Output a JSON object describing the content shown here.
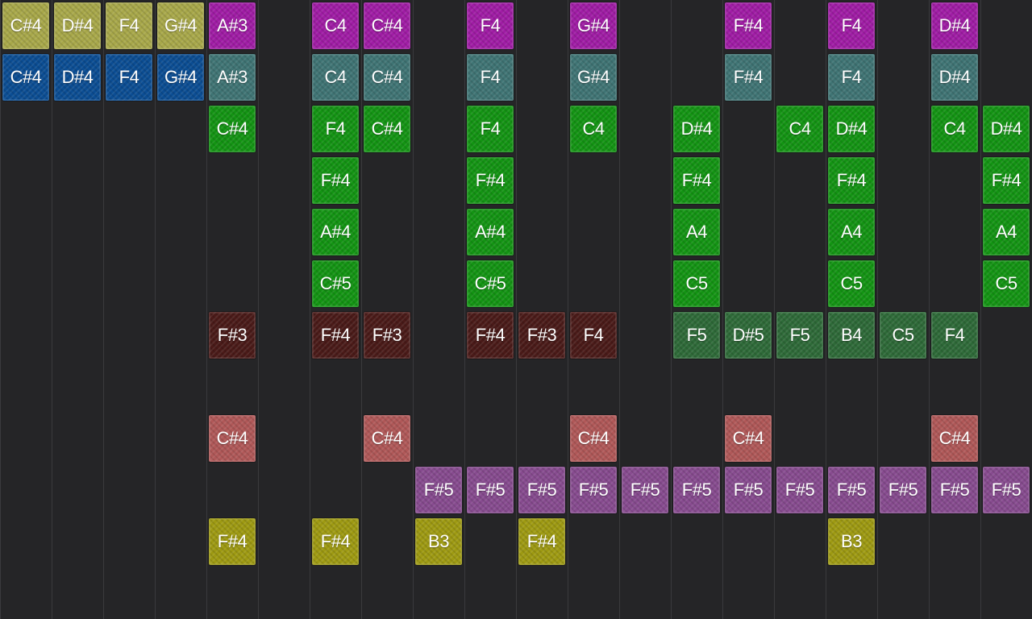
{
  "grid": {
    "columns": 20,
    "rows": 12
  },
  "colors": {
    "olive": "#a8a84a",
    "blue": "#0b4d93",
    "magenta": "#a01ca5",
    "teal": "#3f7474",
    "green": "#139413",
    "maroon": "#4a1a18",
    "darkgreen": "#2e6a38",
    "salmon": "#b05858",
    "purple": "#874b8f",
    "yellow": "#9e9a12"
  },
  "notes": [
    {
      "row": 0,
      "col": 0,
      "label": "C#4",
      "color": "olive"
    },
    {
      "row": 0,
      "col": 1,
      "label": "D#4",
      "color": "olive"
    },
    {
      "row": 0,
      "col": 2,
      "label": "F4",
      "color": "olive"
    },
    {
      "row": 0,
      "col": 3,
      "label": "G#4",
      "color": "olive"
    },
    {
      "row": 0,
      "col": 4,
      "label": "A#3",
      "color": "magenta"
    },
    {
      "row": 0,
      "col": 6,
      "label": "C4",
      "color": "magenta"
    },
    {
      "row": 0,
      "col": 7,
      "label": "C#4",
      "color": "magenta"
    },
    {
      "row": 0,
      "col": 9,
      "label": "F4",
      "color": "magenta"
    },
    {
      "row": 0,
      "col": 11,
      "label": "G#4",
      "color": "magenta"
    },
    {
      "row": 0,
      "col": 14,
      "label": "F#4",
      "color": "magenta"
    },
    {
      "row": 0,
      "col": 16,
      "label": "F4",
      "color": "magenta"
    },
    {
      "row": 0,
      "col": 18,
      "label": "D#4",
      "color": "magenta"
    },
    {
      "row": 1,
      "col": 0,
      "label": "C#4",
      "color": "blue"
    },
    {
      "row": 1,
      "col": 1,
      "label": "D#4",
      "color": "blue"
    },
    {
      "row": 1,
      "col": 2,
      "label": "F4",
      "color": "blue"
    },
    {
      "row": 1,
      "col": 3,
      "label": "G#4",
      "color": "blue"
    },
    {
      "row": 1,
      "col": 4,
      "label": "A#3",
      "color": "teal"
    },
    {
      "row": 1,
      "col": 6,
      "label": "C4",
      "color": "teal"
    },
    {
      "row": 1,
      "col": 7,
      "label": "C#4",
      "color": "teal"
    },
    {
      "row": 1,
      "col": 9,
      "label": "F4",
      "color": "teal"
    },
    {
      "row": 1,
      "col": 11,
      "label": "G#4",
      "color": "teal"
    },
    {
      "row": 1,
      "col": 14,
      "label": "F#4",
      "color": "teal"
    },
    {
      "row": 1,
      "col": 16,
      "label": "F4",
      "color": "teal"
    },
    {
      "row": 1,
      "col": 18,
      "label": "D#4",
      "color": "teal"
    },
    {
      "row": 2,
      "col": 4,
      "label": "C#4",
      "color": "green"
    },
    {
      "row": 2,
      "col": 6,
      "label": "F4",
      "color": "green"
    },
    {
      "row": 2,
      "col": 7,
      "label": "C#4",
      "color": "green"
    },
    {
      "row": 2,
      "col": 9,
      "label": "F4",
      "color": "green"
    },
    {
      "row": 2,
      "col": 11,
      "label": "C4",
      "color": "green"
    },
    {
      "row": 2,
      "col": 13,
      "label": "D#4",
      "color": "green"
    },
    {
      "row": 2,
      "col": 15,
      "label": "C4",
      "color": "green"
    },
    {
      "row": 2,
      "col": 16,
      "label": "D#4",
      "color": "green"
    },
    {
      "row": 2,
      "col": 18,
      "label": "C4",
      "color": "green"
    },
    {
      "row": 2,
      "col": 19,
      "label": "D#4",
      "color": "green"
    },
    {
      "row": 3,
      "col": 6,
      "label": "F#4",
      "color": "green"
    },
    {
      "row": 3,
      "col": 9,
      "label": "F#4",
      "color": "green"
    },
    {
      "row": 3,
      "col": 13,
      "label": "F#4",
      "color": "green"
    },
    {
      "row": 3,
      "col": 16,
      "label": "F#4",
      "color": "green"
    },
    {
      "row": 3,
      "col": 19,
      "label": "F#4",
      "color": "green"
    },
    {
      "row": 4,
      "col": 6,
      "label": "A#4",
      "color": "green"
    },
    {
      "row": 4,
      "col": 9,
      "label": "A#4",
      "color": "green"
    },
    {
      "row": 4,
      "col": 13,
      "label": "A4",
      "color": "green"
    },
    {
      "row": 4,
      "col": 16,
      "label": "A4",
      "color": "green"
    },
    {
      "row": 4,
      "col": 19,
      "label": "A4",
      "color": "green"
    },
    {
      "row": 5,
      "col": 6,
      "label": "C#5",
      "color": "green"
    },
    {
      "row": 5,
      "col": 9,
      "label": "C#5",
      "color": "green"
    },
    {
      "row": 5,
      "col": 13,
      "label": "C5",
      "color": "green"
    },
    {
      "row": 5,
      "col": 16,
      "label": "C5",
      "color": "green"
    },
    {
      "row": 5,
      "col": 19,
      "label": "C5",
      "color": "green"
    },
    {
      "row": 6,
      "col": 4,
      "label": "F#3",
      "color": "maroon"
    },
    {
      "row": 6,
      "col": 6,
      "label": "F#4",
      "color": "maroon"
    },
    {
      "row": 6,
      "col": 7,
      "label": "F#3",
      "color": "maroon"
    },
    {
      "row": 6,
      "col": 9,
      "label": "F#4",
      "color": "maroon"
    },
    {
      "row": 6,
      "col": 10,
      "label": "F#3",
      "color": "maroon"
    },
    {
      "row": 6,
      "col": 11,
      "label": "F4",
      "color": "maroon"
    },
    {
      "row": 6,
      "col": 13,
      "label": "F5",
      "color": "darkgreen"
    },
    {
      "row": 6,
      "col": 14,
      "label": "D#5",
      "color": "darkgreen"
    },
    {
      "row": 6,
      "col": 15,
      "label": "F5",
      "color": "darkgreen"
    },
    {
      "row": 6,
      "col": 16,
      "label": "B4",
      "color": "darkgreen"
    },
    {
      "row": 6,
      "col": 17,
      "label": "C5",
      "color": "darkgreen"
    },
    {
      "row": 6,
      "col": 18,
      "label": "F4",
      "color": "darkgreen"
    },
    {
      "row": 8,
      "col": 4,
      "label": "C#4",
      "color": "salmon"
    },
    {
      "row": 8,
      "col": 7,
      "label": "C#4",
      "color": "salmon"
    },
    {
      "row": 8,
      "col": 11,
      "label": "C#4",
      "color": "salmon"
    },
    {
      "row": 8,
      "col": 14,
      "label": "C#4",
      "color": "salmon"
    },
    {
      "row": 8,
      "col": 18,
      "label": "C#4",
      "color": "salmon"
    },
    {
      "row": 9,
      "col": 8,
      "label": "F#5",
      "color": "purple"
    },
    {
      "row": 9,
      "col": 9,
      "label": "F#5",
      "color": "purple"
    },
    {
      "row": 9,
      "col": 10,
      "label": "F#5",
      "color": "purple"
    },
    {
      "row": 9,
      "col": 11,
      "label": "F#5",
      "color": "purple"
    },
    {
      "row": 9,
      "col": 12,
      "label": "F#5",
      "color": "purple"
    },
    {
      "row": 9,
      "col": 13,
      "label": "F#5",
      "color": "purple"
    },
    {
      "row": 9,
      "col": 14,
      "label": "F#5",
      "color": "purple"
    },
    {
      "row": 9,
      "col": 15,
      "label": "F#5",
      "color": "purple"
    },
    {
      "row": 9,
      "col": 16,
      "label": "F#5",
      "color": "purple"
    },
    {
      "row": 9,
      "col": 17,
      "label": "F#5",
      "color": "purple"
    },
    {
      "row": 9,
      "col": 18,
      "label": "F#5",
      "color": "purple"
    },
    {
      "row": 9,
      "col": 19,
      "label": "F#5",
      "color": "purple"
    },
    {
      "row": 10,
      "col": 4,
      "label": "F#4",
      "color": "yellow"
    },
    {
      "row": 10,
      "col": 6,
      "label": "F#4",
      "color": "yellow"
    },
    {
      "row": 10,
      "col": 8,
      "label": "B3",
      "color": "yellow"
    },
    {
      "row": 10,
      "col": 10,
      "label": "F#4",
      "color": "yellow"
    },
    {
      "row": 10,
      "col": 16,
      "label": "B3",
      "color": "yellow"
    }
  ]
}
